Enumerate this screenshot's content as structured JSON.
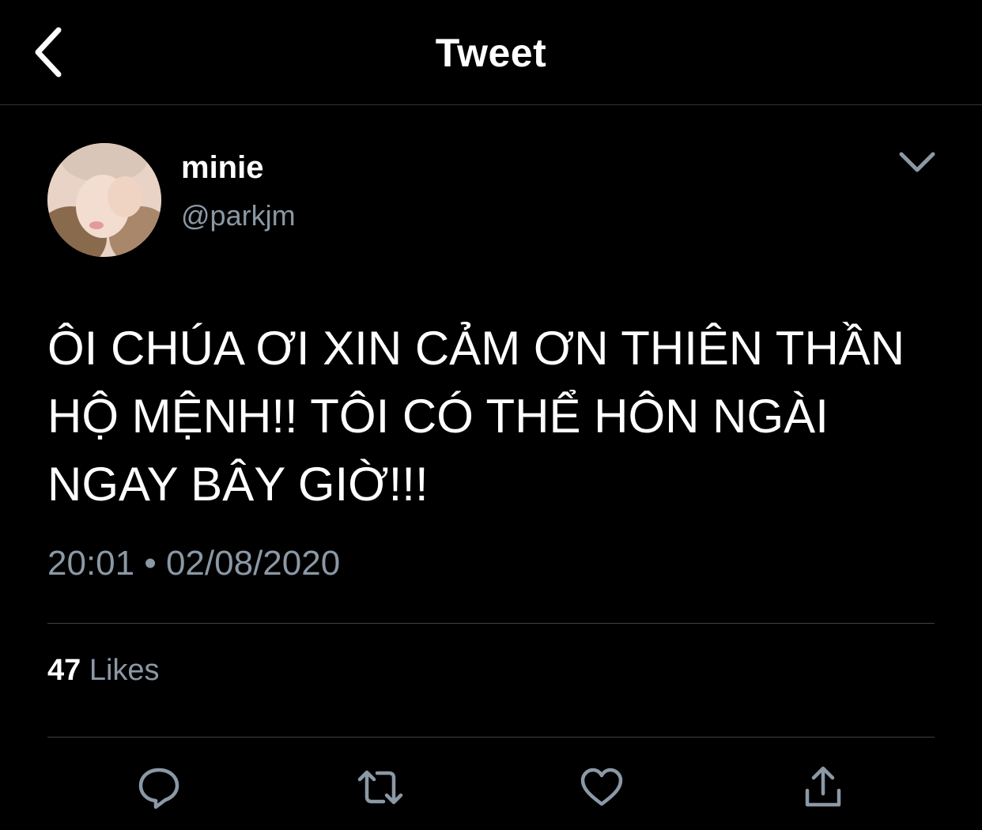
{
  "header": {
    "title": "Tweet",
    "back_icon": "chevron-left-icon"
  },
  "author": {
    "display_name": "minie",
    "handle": "@parkjm",
    "more_icon": "chevron-down-icon"
  },
  "tweet": {
    "text_lines": [
      "ÔI CHÚA ƠI XIN CẢM ƠN THIÊN THẦN",
      "HỘ MỆNH!! TÔI CÓ THỂ HÔN NGÀI",
      "NGAY BÂY GIỜ!!!"
    ],
    "timestamp": "20:01 • 02/08/2020"
  },
  "stats": {
    "likes_count": "47",
    "likes_label": "Likes"
  },
  "actions": [
    {
      "name": "reply",
      "icon": "reply-icon"
    },
    {
      "name": "retweet",
      "icon": "retweet-icon"
    },
    {
      "name": "like",
      "icon": "heart-icon"
    },
    {
      "name": "share",
      "icon": "share-icon"
    }
  ],
  "colors": {
    "background": "#000000",
    "text": "#ffffff",
    "secondary_text": "#8b98a5",
    "divider": "#3d4247"
  }
}
